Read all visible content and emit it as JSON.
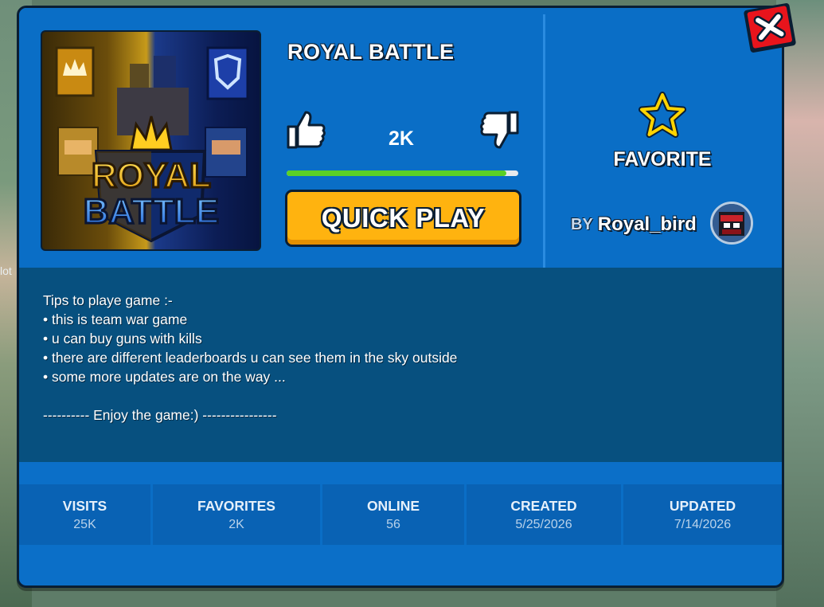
{
  "background": {
    "partial_label": "lot"
  },
  "game": {
    "title": "ROYAL BATTLE",
    "thumbnail_text_line1": "ROYAL",
    "thumbnail_text_line2": "BATTLE",
    "likes": "2K",
    "like_ratio": 0.95,
    "play_button": "QUICK PLAY",
    "favorite_label": "FAVORITE",
    "creator_prefix": "BY",
    "creator_name": "Royal_bird",
    "description": "Tips to playe game :-\n• this is team war game\n• u can buy guns with kills\n• there are different leaderboards u can see them in the sky outside\n• some more updates are on the way ...\n\n---------- Enjoy the game:) ----------------"
  },
  "stats": [
    {
      "label": "VISITS",
      "value": "25K"
    },
    {
      "label": "FAVORITES",
      "value": "2K"
    },
    {
      "label": "ONLINE",
      "value": "56"
    },
    {
      "label": "CREATED",
      "value": "5/25/2026"
    },
    {
      "label": "UPDATED",
      "value": "7/14/2026"
    }
  ],
  "icons": {
    "like": "thumbs-up-icon",
    "dislike": "thumbs-down-icon",
    "favorite": "star-outline-icon",
    "close": "close-x-icon"
  },
  "colors": {
    "panel": "#0a6ec6",
    "description_bg": "#07507f",
    "play_button": "#ffb30f",
    "close_button": "#e8141c",
    "star": "#ffd400",
    "ratio_fill": "#5bd026"
  }
}
